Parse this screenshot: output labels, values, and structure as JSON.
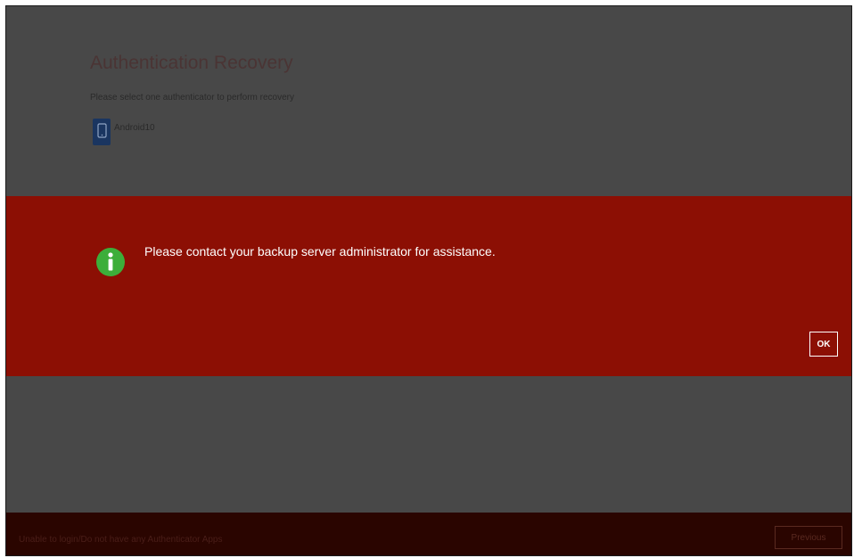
{
  "header": {
    "title": "Authentication Recovery",
    "subtitle": "Please select one authenticator to perform recovery"
  },
  "authenticators": [
    {
      "label": "Android10",
      "icon": "phone-icon"
    }
  ],
  "alert": {
    "message": "Please contact your backup server administrator for assistance.",
    "icon": "info-icon",
    "ok_label": "OK",
    "background_color": "#8c0f04",
    "icon_color": "#3dae3a"
  },
  "footer": {
    "text": "Unable to login/Do not have any Authenticator Apps",
    "previous_label": "Previous"
  }
}
